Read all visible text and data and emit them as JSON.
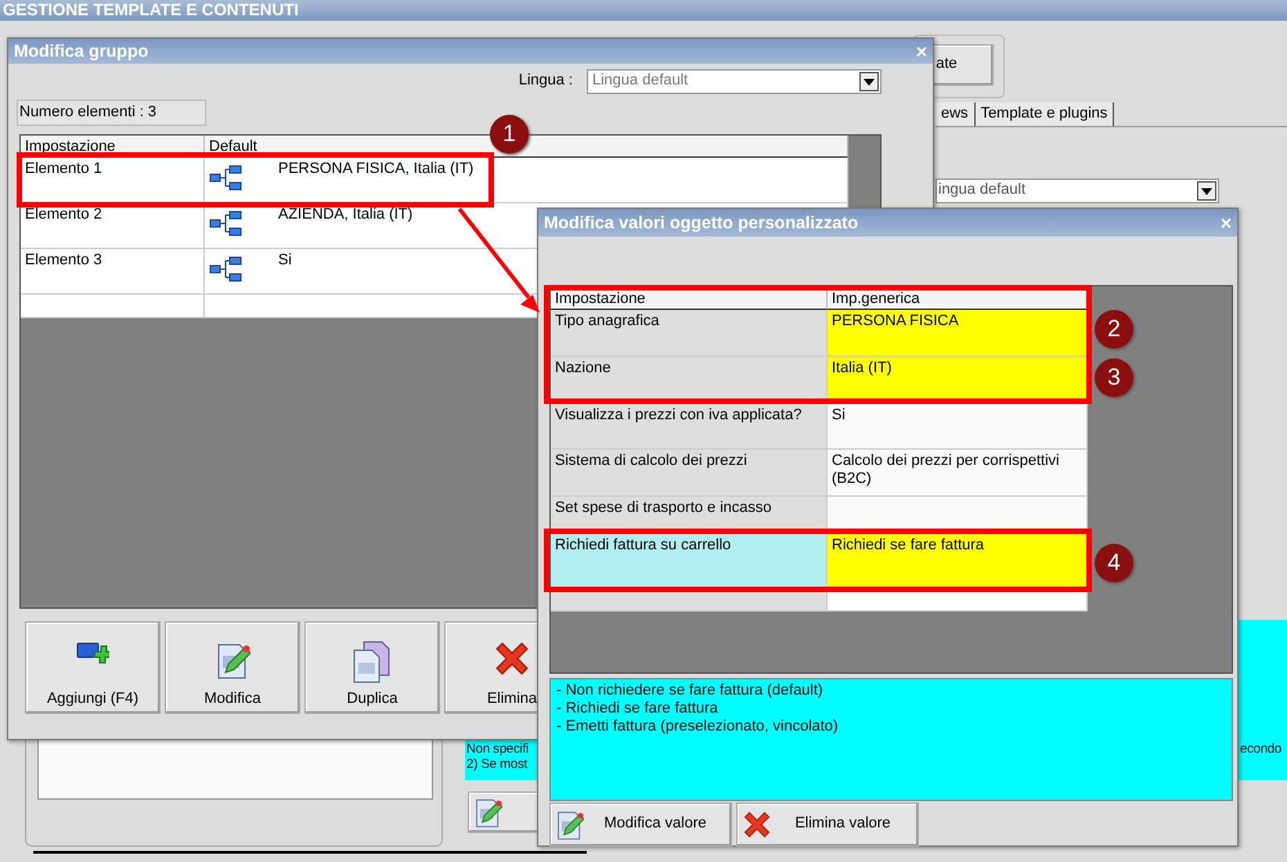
{
  "app": {
    "title": "GESTIONE TEMPLATE E CONTENUTI",
    "button": "ate",
    "tabs": [
      "ews",
      "Template e plugins"
    ],
    "language_select": "ingua default",
    "help_lines": [
      "Non specifi",
      "2) Se most"
    ],
    "help_right": "econdo"
  },
  "group_dialog": {
    "title": "Modifica gruppo",
    "close": "×",
    "language_label": "Lingua :",
    "language_value": "Lingua default",
    "count": "Numero elementi : 3",
    "columns": [
      "Impostazione",
      "Default"
    ],
    "rows": [
      {
        "name": "Elemento 1",
        "value": "PERSONA FISICA, Italia (IT)"
      },
      {
        "name": "Elemento 2",
        "value": "AZIENDA, Italia (IT)"
      },
      {
        "name": "Elemento 3",
        "value": "Si"
      }
    ],
    "buttons": [
      {
        "label": "Aggiungi (F4)",
        "kind": "add"
      },
      {
        "label": "Modifica",
        "kind": "edit"
      },
      {
        "label": "Duplica",
        "kind": "copy"
      },
      {
        "label": "Elimina",
        "kind": "delete"
      }
    ]
  },
  "values_dialog": {
    "title": "Modifica valori oggetto personalizzato",
    "close": "×",
    "columns": [
      "Impostazione",
      "Imp.generica"
    ],
    "rows": [
      {
        "name": "Tipo anagrafica",
        "value": "PERSONA FISICA",
        "highlighted": true,
        "selected": false
      },
      {
        "name": "Nazione",
        "value": "Italia (IT)",
        "highlighted": true,
        "selected": false
      },
      {
        "name": "Visualizza i prezzi con iva applicata?",
        "value": "Si",
        "highlighted": false,
        "selected": false
      },
      {
        "name": "Sistema di calcolo dei prezzi",
        "value": "Calcolo dei prezzi per corrispettivi (B2C)",
        "highlighted": false,
        "selected": false
      },
      {
        "name": "Set spese di trasporto e incasso",
        "value": "",
        "highlighted": false,
        "selected": false
      },
      {
        "name": "Richiedi fattura su carrello",
        "value": "Richiedi se fare fattura",
        "highlighted": true,
        "selected": true
      }
    ],
    "description": [
      "- Non richiedere se fare fattura (default)",
      "- Richiedi se fare fattura",
      "- Emetti fattura (preselezionato, vincolato)"
    ],
    "buttons": [
      {
        "label": "Modifica valore",
        "kind": "edit"
      },
      {
        "label": "Elimina valore",
        "kind": "delete"
      }
    ]
  },
  "callouts": [
    "1",
    "2",
    "3",
    "4"
  ]
}
